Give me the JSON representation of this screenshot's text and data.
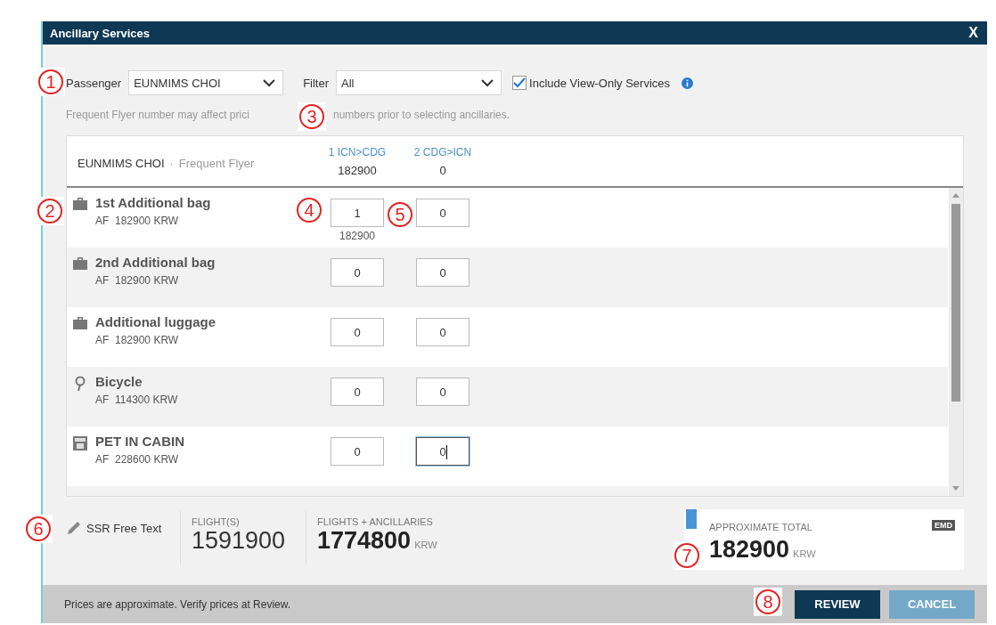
{
  "window": {
    "title": "Ancillary Services",
    "close": "X"
  },
  "filters": {
    "passenger_label": "Passenger",
    "passenger": "EUNMIMS CHOI",
    "filter_label": "Filter",
    "filter": "All",
    "include_view_only": {
      "label": "Include View-Only Services",
      "checked": true
    }
  },
  "hint": [
    "Frequent Flyer number may affect prici",
    "numbers prior to selecting ancillaries."
  ],
  "table": {
    "passenger": "EUNMIMS CHOI",
    "separator": "·",
    "frequent_flyer": "Frequent Flyer",
    "segments": [
      {
        "label": "1 ICN>CDG",
        "total": "182900"
      },
      {
        "label": "2 CDG>ICN",
        "total": "0"
      }
    ],
    "rows": [
      {
        "kind": "bag",
        "name": "1st Additional bag",
        "price": "AF  182900 KRW",
        "inputs": [
          {
            "value": "1",
            "focused": false,
            "subtotal": "182900"
          },
          {
            "value": "0",
            "focused": false
          }
        ]
      },
      {
        "kind": "bag",
        "name": "2nd Additional bag",
        "price": "AF  182900 KRW",
        "inputs": [
          {
            "value": "0",
            "focused": false
          },
          {
            "value": "0",
            "focused": false
          }
        ]
      },
      {
        "kind": "bag",
        "name": "Additional luggage",
        "price": "AF  182900 KRW",
        "inputs": [
          {
            "value": "0",
            "focused": false
          },
          {
            "value": "0",
            "focused": false
          }
        ]
      },
      {
        "kind": "bicycle",
        "name": "Bicycle",
        "price": "AF  114300 KRW",
        "inputs": [
          {
            "value": "0",
            "focused": false
          },
          {
            "value": "0",
            "focused": false
          }
        ]
      },
      {
        "kind": "pet",
        "name": "PET IN CABIN",
        "price": "AF  228600 KRW",
        "inputs": [
          {
            "value": "0",
            "focused": false
          },
          {
            "value": "0",
            "focused": true
          }
        ]
      }
    ]
  },
  "footer": {
    "ssr": "SSR Free Text",
    "flights_label": "FLIGHT(S)",
    "flights": "1591900",
    "combined_label": "FLIGHTS + ANCILLARIES",
    "combined": "1774800",
    "combined_currency": "KRW",
    "total_label": "APPROXIMATE TOTAL",
    "total_badge": "EMD",
    "total": "182900",
    "total_currency": "KRW"
  },
  "status_bar": {
    "note": "Prices are approximate. Verify prices at Review.",
    "buttons": [
      {
        "label": "REVIEW",
        "kind": "primary"
      },
      {
        "label": "CANCEL",
        "kind": "secondary"
      }
    ]
  },
  "callouts": [
    "1",
    "2",
    "3",
    "4",
    "5",
    "6",
    "7",
    "8"
  ]
}
